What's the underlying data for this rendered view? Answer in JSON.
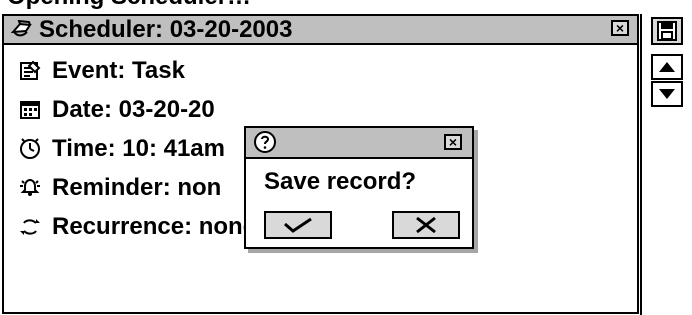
{
  "top_cut_text": "Opening Scheduler…",
  "window": {
    "title": "Scheduler:  03-20-2003",
    "close_glyph": "×",
    "rows": [
      {
        "icon": "event-note-icon",
        "text": "Event: Task"
      },
      {
        "icon": "calendar-icon",
        "text": "Date: 03-20-20"
      },
      {
        "icon": "clock-icon",
        "text": "Time: 10: 41am"
      },
      {
        "icon": "reminder-icon",
        "text": "Reminder: non"
      },
      {
        "icon": "recurrence-icon",
        "text": "Recurrence: none"
      }
    ]
  },
  "dialog": {
    "message": "Save record?",
    "close_glyph": "×",
    "ok_glyph": "✓",
    "cancel_glyph": "X"
  },
  "right_panel": {
    "save_icon": "floppy-disk-icon",
    "up_glyph": "▲",
    "down_glyph": "▼"
  }
}
